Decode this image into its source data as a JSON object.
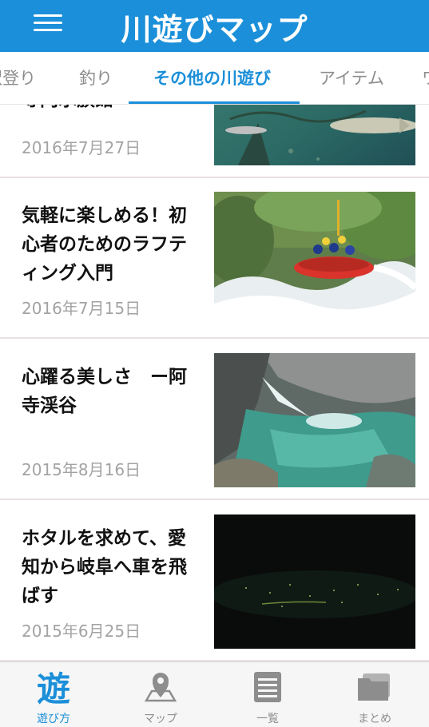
{
  "header": {
    "title": "川遊びマップ",
    "menu_icon": "hamburger-menu-icon"
  },
  "tabs": [
    {
      "label": "沢登り",
      "active": false
    },
    {
      "label": "釣り",
      "active": false
    },
    {
      "label": "その他の川遊び",
      "active": true
    },
    {
      "label": "アイテム",
      "active": false
    },
    {
      "label": "ワ",
      "active": false
    }
  ],
  "articles": [
    {
      "title": "寺門水族館",
      "date": "2016年7月27日",
      "thumbnail": "fish-in-water"
    },
    {
      "title": "気軽に楽しめる！初心者のためのラフティング入門",
      "date": "2016年7月15日",
      "thumbnail": "rafting"
    },
    {
      "title": "心躍る美しさ　ー阿寺渓谷",
      "date": "2015年8月16日",
      "thumbnail": "gorge-pool"
    },
    {
      "title": "ホタルを求めて、愛知から岐阜へ車を飛ばす",
      "date": "2015年6月25日",
      "thumbnail": "fireflies-night"
    }
  ],
  "bottom_nav": [
    {
      "label": "遊び方",
      "icon": "play-kanji-icon",
      "active": true
    },
    {
      "label": "マップ",
      "icon": "map-pin-icon",
      "active": false
    },
    {
      "label": "一覧",
      "icon": "list-icon",
      "active": false
    },
    {
      "label": "まとめ",
      "icon": "folder-icon",
      "active": false
    }
  ],
  "colors": {
    "brand": "#1b8fd9",
    "inactive": "#8d8d8d",
    "date": "#a3a3a3",
    "divider": "#e9dfe3"
  }
}
